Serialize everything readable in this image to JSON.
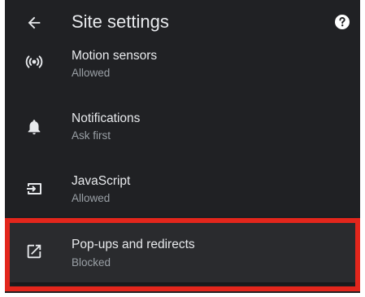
{
  "app_bar": {
    "title": "Site settings",
    "back_icon": "arrow-left-icon",
    "help_icon": "help-circle-icon"
  },
  "settings": [
    {
      "label": "Motion sensors",
      "status": "Allowed",
      "icon": "motion-sensors-icon"
    },
    {
      "label": "Notifications",
      "status": "Ask first",
      "icon": "bell-icon"
    },
    {
      "label": "JavaScript",
      "status": "Allowed",
      "icon": "javascript-icon"
    },
    {
      "label": "Pop-ups and redirects",
      "status": "Blocked",
      "icon": "open-in-new-icon"
    }
  ],
  "colors": {
    "background": "#202124",
    "text_primary": "#e8eaed",
    "text_secondary": "#9aa0a6",
    "highlight_border": "#e3261c"
  }
}
